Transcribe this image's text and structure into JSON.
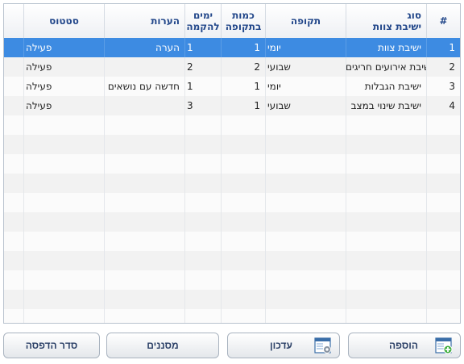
{
  "columns": {
    "num": "#",
    "type": "סוג\nישיבת צוות",
    "period": "תקופה",
    "quantity": "כמות\nבתקופה",
    "days": "ימים\nלהקמה",
    "notes": "הערות",
    "status": "סטטוס"
  },
  "rows": [
    {
      "num": "1",
      "type": "ישיבת צוות",
      "period": "יומי",
      "quantity": "1",
      "days": "1",
      "notes": "הערה",
      "status": "פעילה",
      "selected": true
    },
    {
      "num": "2",
      "type": "ישיבת אירועים חריגים",
      "period": "שבועי",
      "quantity": "2",
      "days": "2",
      "notes": "",
      "status": "פעילה",
      "selected": false
    },
    {
      "num": "3",
      "type": "ישיבת הגבלות",
      "period": "יומי",
      "quantity": "1",
      "days": "1",
      "notes": "חדשה עם נושאים",
      "status": "פעילה",
      "selected": false
    },
    {
      "num": "4",
      "type": "ישיבת שינוי במצב",
      "period": "שבועי",
      "quantity": "1",
      "days": "3",
      "notes": "",
      "status": "פעילה",
      "selected": false
    }
  ],
  "buttons": {
    "add": "הוספה",
    "update": "עדכון",
    "filters": "מסננים",
    "print_order": "סדר הדפסה"
  },
  "icons": {
    "add": "add-record-icon",
    "update": "edit-record-icon"
  },
  "colors": {
    "selected_row": "#3d8be2",
    "header_text": "#22478a"
  }
}
